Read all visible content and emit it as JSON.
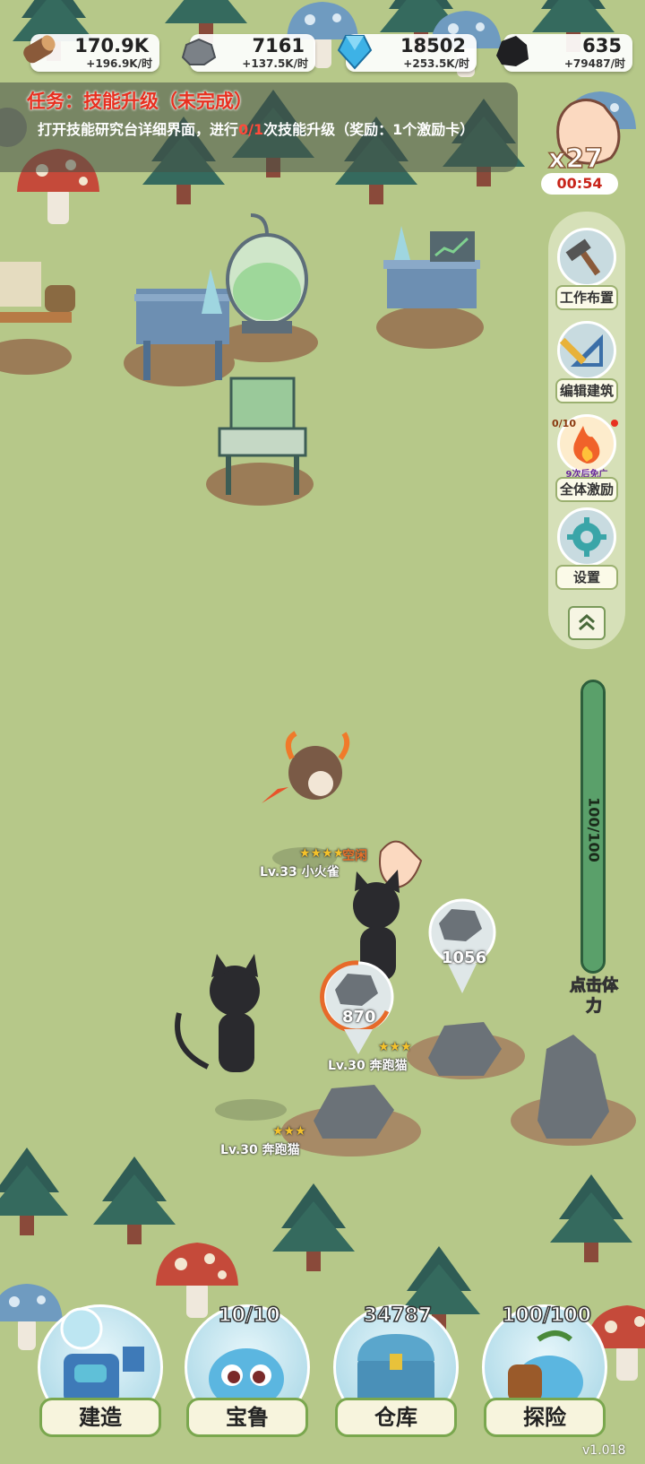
{
  "resources": [
    {
      "icon": "wood-log-icon",
      "amount": "170.9K",
      "rate": "+196.9K/时"
    },
    {
      "icon": "stone-icon",
      "amount": "7161",
      "rate": "+137.5K/时"
    },
    {
      "icon": "blue-crystal-icon",
      "amount": "18502",
      "rate": "+253.5K/时"
    },
    {
      "icon": "coal-icon",
      "amount": "635",
      "rate": "+79487/时"
    }
  ],
  "task": {
    "title": "任务：技能升级（未完成）",
    "desc_pre": "打开技能研究台详细界面，进行",
    "desc_progress": "0/1",
    "desc_post": "次技能升级（奖励：1个激励卡）"
  },
  "tap_boost": {
    "multiplier": "x27",
    "timer": "00:54"
  },
  "side_menu": [
    {
      "icon": "hammer-icon",
      "label": "工作布置"
    },
    {
      "icon": "ruler-icon",
      "label": "编辑建筑"
    },
    {
      "icon": "fire-icon",
      "label": "全体激励",
      "progress": "0/10",
      "note": "9次后免广"
    },
    {
      "icon": "gear-icon",
      "label": "设置"
    }
  ],
  "stamina": {
    "value": "100/100",
    "fill": 1.0,
    "label": "点击体力"
  },
  "pets": [
    {
      "label": "Lv.33 小火雀",
      "stars": "★★★★",
      "status": "空闲"
    },
    {
      "label": "Lv.30 奔跑猫",
      "stars": "★★★"
    },
    {
      "label": "Lv.30 奔跑猫",
      "stars": "★★★"
    }
  ],
  "rocks": [
    {
      "value": "1056"
    },
    {
      "value": "870"
    }
  ],
  "bottom_nav": [
    {
      "label": "建造",
      "count": ""
    },
    {
      "label": "宝鲁",
      "count": "10/10"
    },
    {
      "label": "仓库",
      "count": "34787"
    },
    {
      "label": "探险",
      "count": "100/100"
    }
  ],
  "version": "v1.018"
}
